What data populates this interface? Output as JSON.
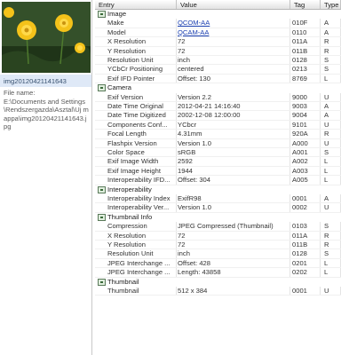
{
  "sidebar": {
    "caption": "img20120421141643",
    "file_label": "File name:",
    "file_path": "E:\\Documents and Settings\\Rendszergazda\\Asztal\\Uj mappa\\img20120421141643.jpg"
  },
  "columns": [
    "Entry",
    "Value",
    "Tag",
    "Type"
  ],
  "rows": [
    {
      "kind": "group",
      "label": "Image",
      "icon": "image-group-icon"
    },
    {
      "kind": "data",
      "entry": "Make",
      "value": "QCOM-AA",
      "tag": "010F",
      "type": "A",
      "link": true
    },
    {
      "kind": "data",
      "entry": "Model",
      "value": "QCAM-AA",
      "tag": "0110",
      "type": "A",
      "link": true
    },
    {
      "kind": "data",
      "entry": "X Resolution",
      "value": "72",
      "tag": "011A",
      "type": "R"
    },
    {
      "kind": "data",
      "entry": "Y Resolution",
      "value": "72",
      "tag": "011B",
      "type": "R"
    },
    {
      "kind": "data",
      "entry": "Resolution Unit",
      "value": "inch",
      "tag": "0128",
      "type": "S"
    },
    {
      "kind": "data",
      "entry": "YCbCr Positioning",
      "value": "centered",
      "tag": "0213",
      "type": "S"
    },
    {
      "kind": "data",
      "entry": "Exif IFD Pointer",
      "value": "Offset: 130",
      "tag": "8769",
      "type": "L"
    },
    {
      "kind": "group",
      "label": "Camera",
      "icon": "camera-group-icon"
    },
    {
      "kind": "data",
      "entry": "Exif Version",
      "value": "Version 2.2",
      "tag": "9000",
      "type": "U"
    },
    {
      "kind": "data",
      "entry": "Date Time Original",
      "value": "2012-04-21 14:16:40",
      "tag": "9003",
      "type": "A"
    },
    {
      "kind": "data",
      "entry": "Date Time Digitized",
      "value": "2002-12-08 12:00:00",
      "tag": "9004",
      "type": "A"
    },
    {
      "kind": "data",
      "entry": "Components Conf...",
      "value": "YCbcr",
      "tag": "9101",
      "type": "U"
    },
    {
      "kind": "data",
      "entry": "Focal Length",
      "value": "4.31mm",
      "tag": "920A",
      "type": "R"
    },
    {
      "kind": "data",
      "entry": "Flashpix Version",
      "value": "Version 1.0",
      "tag": "A000",
      "type": "U"
    },
    {
      "kind": "data",
      "entry": "Color Space",
      "value": "sRGB",
      "tag": "A001",
      "type": "S"
    },
    {
      "kind": "data",
      "entry": "Exif Image Width",
      "value": "2592",
      "tag": "A002",
      "type": "L"
    },
    {
      "kind": "data",
      "entry": "Exif Image Height",
      "value": "1944",
      "tag": "A003",
      "type": "L"
    },
    {
      "kind": "data",
      "entry": "Interoperability IFD...",
      "value": "Offset: 304",
      "tag": "A005",
      "type": "L"
    },
    {
      "kind": "group",
      "label": "Interoperability",
      "icon": "interoperability-group-icon"
    },
    {
      "kind": "data",
      "entry": "Interoperability Index",
      "value": "ExifR98",
      "tag": "0001",
      "type": "A"
    },
    {
      "kind": "data",
      "entry": "Interoperability Ver...",
      "value": "Version 1.0",
      "tag": "0002",
      "type": "U"
    },
    {
      "kind": "group",
      "label": "Thumbnail Info",
      "icon": "thumbnail-info-group-icon"
    },
    {
      "kind": "data",
      "entry": "Compression",
      "value": "JPEG Compressed (Thumbnail)",
      "tag": "0103",
      "type": "S"
    },
    {
      "kind": "data",
      "entry": "X Resolution",
      "value": "72",
      "tag": "011A",
      "type": "R"
    },
    {
      "kind": "data",
      "entry": "Y Resolution",
      "value": "72",
      "tag": "011B",
      "type": "R"
    },
    {
      "kind": "data",
      "entry": "Resolution Unit",
      "value": "inch",
      "tag": "0128",
      "type": "S"
    },
    {
      "kind": "data",
      "entry": "JPEG Interchange ...",
      "value": "Offset: 428",
      "tag": "0201",
      "type": "L"
    },
    {
      "kind": "data",
      "entry": "JPEG Interchange ...",
      "value": "Length: 43858",
      "tag": "0202",
      "type": "L"
    },
    {
      "kind": "group",
      "label": "Thumbnail",
      "icon": "thumbnail-group-icon"
    },
    {
      "kind": "data",
      "entry": "Thumbnail",
      "value": "512 x 384",
      "tag": "0001",
      "type": "U"
    }
  ],
  "colors": {
    "caption_bg": "#dfe9f7",
    "link": "#1a3fb0",
    "header_bottom": "#e2e2e2"
  }
}
